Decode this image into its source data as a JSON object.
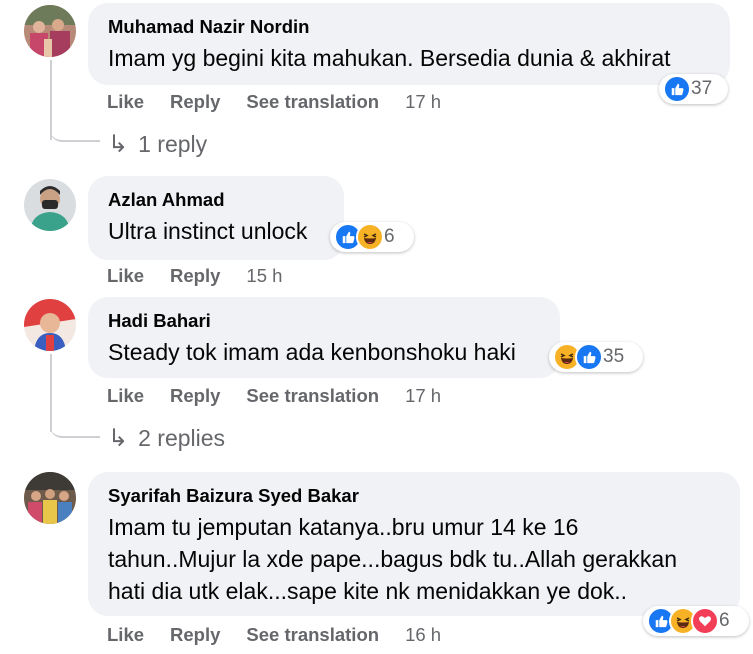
{
  "actions": {
    "like": "Like",
    "reply": "Reply",
    "see_translation": "See translation"
  },
  "comments": [
    {
      "author": "Muhamad Nazir Nordin",
      "text": "Imam yg begini kita mahukan. Bersedia dunia & akhirat",
      "time": "17 h",
      "reaction_count": "37",
      "reactions": [
        "like-icon"
      ],
      "replies_label": "1 reply"
    },
    {
      "author": "Azlan Ahmad",
      "text": "Ultra instinct unlock",
      "time": "15 h",
      "reaction_count": "6",
      "reactions": [
        "like-icon",
        "haha-icon"
      ]
    },
    {
      "author": "Hadi Bahari",
      "text": "Steady tok imam ada kenbonshoku haki",
      "time": "17 h",
      "reaction_count": "35",
      "reactions": [
        "haha-icon",
        "like-icon"
      ],
      "replies_label": "2 replies"
    },
    {
      "author": "Syarifah Baizura Syed Bakar",
      "text_lines": [
        "Imam tu jemputan katanya..bru umur 14 ke 16",
        "tahun..Mujur la xde pape...bagus bdk tu..Allah gerakkan",
        "hati dia utk elak...sape kite nk menidakkan ye dok.."
      ],
      "time": "16 h",
      "reaction_count": "6",
      "reactions": [
        "like-icon",
        "haha-icon",
        "heart-icon"
      ]
    }
  ],
  "colors": {
    "bubble": "#f0f2f5",
    "secondary_text": "#65676b",
    "like_blue": "#1877f2",
    "haha_yellow": "#f7b125",
    "love_red": "#f33e58"
  }
}
